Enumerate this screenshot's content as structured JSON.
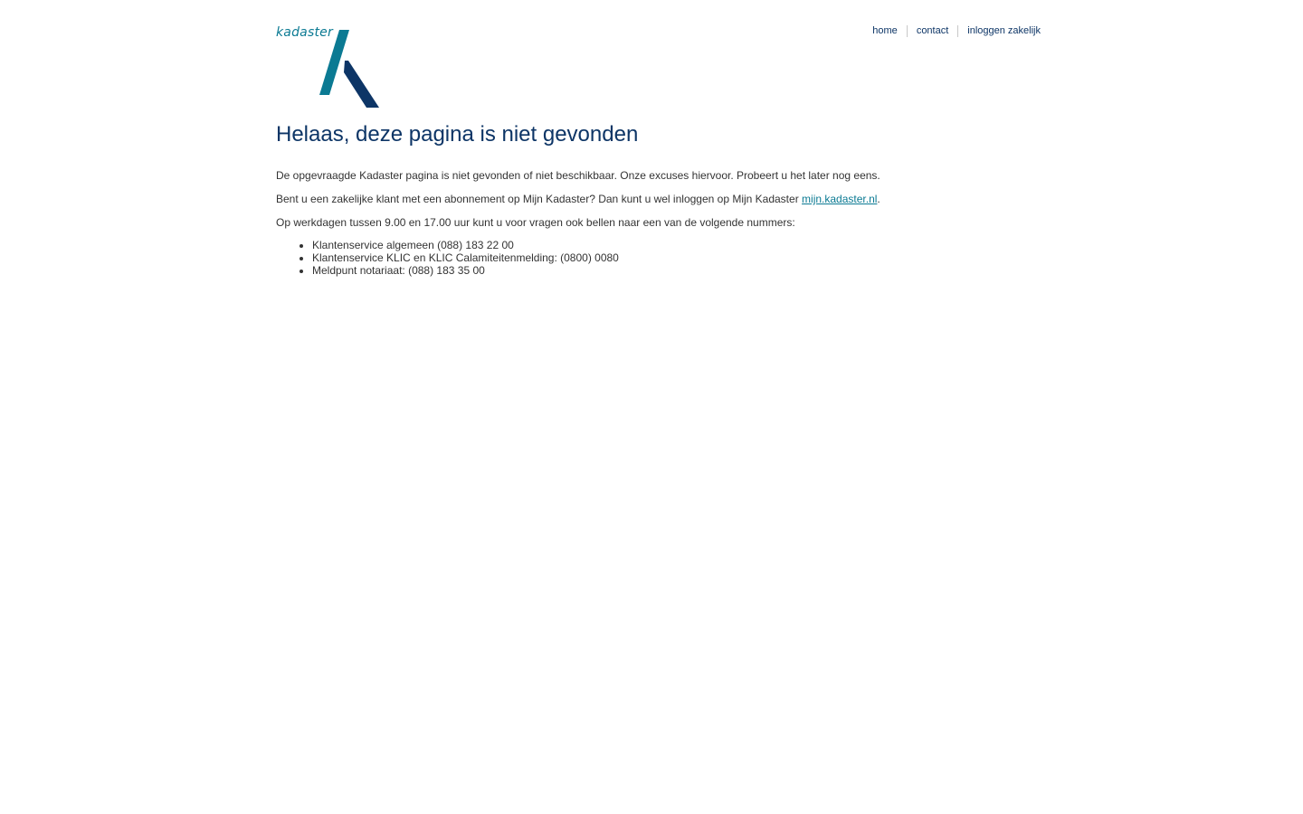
{
  "logo": {
    "text": "kadaster",
    "colors": {
      "light": "#0b7a93",
      "dark": "#0d3566"
    }
  },
  "nav": {
    "items": [
      {
        "label": "home"
      },
      {
        "label": "contact"
      },
      {
        "label": "inloggen zakelijk"
      }
    ]
  },
  "main": {
    "title": "Helaas, deze pagina is niet gevonden",
    "paragraph1": "De opgevraagde Kadaster pagina is niet gevonden of niet beschikbaar. Onze excuses hiervoor. Probeert u het later nog eens.",
    "paragraph2_prefix": "Bent u een zakelijke klant met een abonnement op Mijn Kadaster? Dan kunt u wel inloggen op Mijn Kadaster ",
    "paragraph2_link": "mijn.kadaster.nl",
    "paragraph2_suffix": ".",
    "paragraph3": "Op werkdagen tussen 9.00 en 17.00 uur kunt u voor vragen ook bellen naar een van de volgende nummers:",
    "phone_list": [
      "Klantenservice algemeen (088) 183 22 00",
      "Klantenservice KLIC en KLIC Calamiteitenmelding: (0800) 0080",
      "Meldpunt notariaat: (088) 183 35 00"
    ]
  }
}
